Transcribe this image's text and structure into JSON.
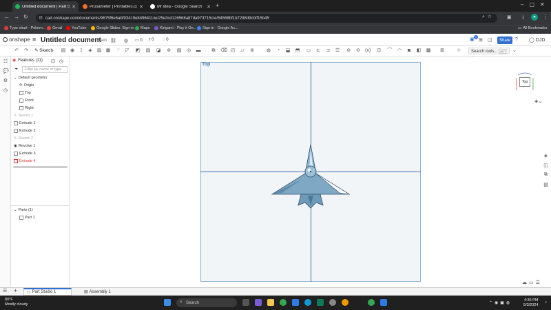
{
  "browser": {
    "tabs": [
      {
        "title": "Untitled document | Part Studio",
        "color": "#1db954",
        "active": true
      },
      {
        "title": "Prusameter | Printables.com",
        "color": "#f26b2a",
        "active": false
      },
      {
        "title": "Mr idea - Google Search",
        "color": "#ffffff",
        "active": false
      }
    ],
    "new_tab_label": "+",
    "url": "cad.onshape.com/documents/9675f6e6abf93419e8496411/w/25e3cd126568a87da973715c/e/54568bf1b7298d9cbff15b45",
    "bookmarks": [
      {
        "label": "Type chart - Pokem...",
        "color": "#e53935"
      },
      {
        "label": "Gmail",
        "color": "#ea4335"
      },
      {
        "label": "YouTube",
        "color": "#ff0000"
      },
      {
        "label": "Google Slides: Sign-in",
        "color": "#fbbc04"
      },
      {
        "label": "Maps",
        "color": "#34a853"
      },
      {
        "label": "Kirigami - Play it On...",
        "color": "#7e57c2"
      },
      {
        "label": "Sign in - Google Ac...",
        "color": "#4285f4"
      }
    ],
    "all_bookmarks": "All Bookmarks"
  },
  "app": {
    "logo_text": "onshape",
    "document_title": "Untitled document",
    "branch": "Main",
    "counter_a": "0",
    "counter_b": "0",
    "counter_c": "0",
    "share_label": "Share",
    "user_initials": "DJD",
    "notifications": "1"
  },
  "toolbar": {
    "sketch_label": "Sketch",
    "search_tools_label": "Search tools...",
    "search_shortcut": "alt/⌥ C"
  },
  "feature_tree": {
    "header": "Features (11)",
    "filter_placeholder": "Filter by name or type",
    "default_geometry": "Default geometry",
    "geometry_items": [
      "Origin",
      "Top",
      "Front",
      "Right"
    ],
    "features": [
      {
        "label": "Sketch 1",
        "state": "muted"
      },
      {
        "label": "Extrude 1",
        "state": "normal"
      },
      {
        "label": "Extrude 2",
        "state": "normal"
      },
      {
        "label": "Sketch 2",
        "state": "muted"
      },
      {
        "label": "Revolve 1",
        "state": "normal"
      },
      {
        "label": "Extrude 3",
        "state": "normal"
      },
      {
        "label": "Extrude 4",
        "state": "error"
      }
    ],
    "parts_header": "Parts (1)",
    "parts": [
      "Part 1"
    ]
  },
  "viewport": {
    "plane_label": "Top",
    "view_cube_label": "Top",
    "model_color": "#7fa8c4"
  },
  "bottom_tabs": [
    {
      "label": "Part Studio 1",
      "active": true
    },
    {
      "label": "Assembly 1",
      "active": false
    }
  ],
  "taskbar": {
    "weather_temp": "80°F",
    "weather_desc": "Mostly cloudy",
    "search_label": "Search",
    "time": "4:35 PM",
    "date": "5/3/2024"
  }
}
